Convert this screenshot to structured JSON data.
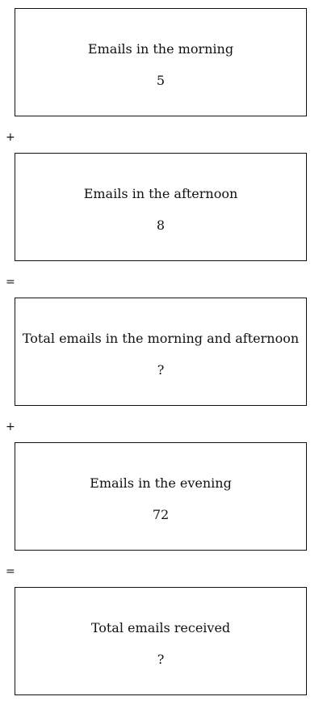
{
  "steps": [
    {
      "label": "Emails in the morning",
      "value": "5"
    },
    {
      "label": "Emails in the afternoon",
      "value": "8"
    },
    {
      "label": "Total emails in the morning and afternoon",
      "value": "?"
    },
    {
      "label": "Emails in the evening",
      "value": "72"
    },
    {
      "label": "Total emails received",
      "value": "?"
    }
  ],
  "operators": [
    "+",
    "=",
    "+",
    "="
  ]
}
